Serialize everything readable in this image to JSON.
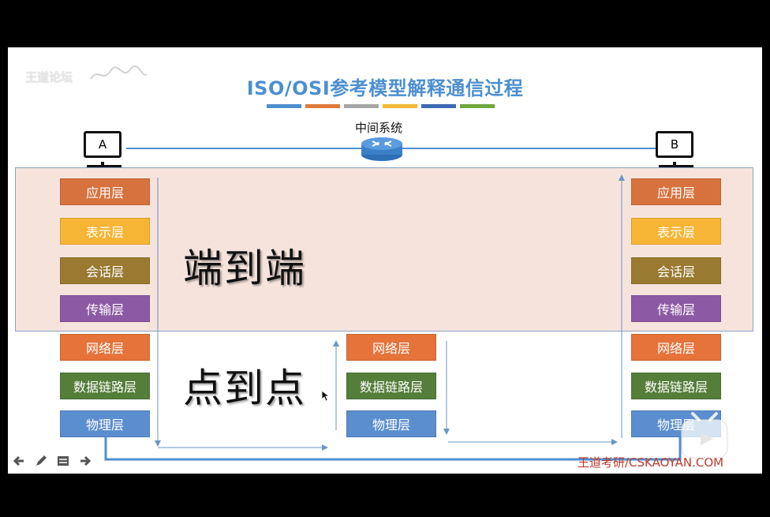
{
  "slide": {
    "title": "ISO/OSI参考模型解释通信过程",
    "watermark_text": "王道论坛",
    "title_bar_colors": [
      "#4f8fd0",
      "#e07b39",
      "#a6a6a6",
      "#f5b935",
      "#3f68b3",
      "#6fa83d"
    ]
  },
  "network": {
    "host_a_label": "A",
    "host_b_label": "B",
    "middle_system_label": "中间系统",
    "line_color": "#4f8fd0",
    "router_color": "#3c7fc9"
  },
  "regions": {
    "end_to_end_label": "端到端",
    "point_to_point_label": "点到点",
    "end_to_end_bg": "#f6e4dc"
  },
  "stack_a": [
    {
      "label": "应用层",
      "color": "#d7723e"
    },
    {
      "label": "表示层",
      "color": "#f6b535"
    },
    {
      "label": "会话层",
      "color": "#9a7a31"
    },
    {
      "label": "传输层",
      "color": "#8c5aa5"
    },
    {
      "label": "网络层",
      "color": "#e5733a"
    },
    {
      "label": "数据链路层",
      "color": "#547e3a"
    },
    {
      "label": "物理层",
      "color": "#5b8ecf"
    }
  ],
  "stack_mid": [
    {
      "label": "网络层",
      "color": "#e5733a"
    },
    {
      "label": "数据链路层",
      "color": "#547e3a"
    },
    {
      "label": "物理层",
      "color": "#5b8ecf"
    }
  ],
  "stack_b": [
    {
      "label": "应用层",
      "color": "#d7723e"
    },
    {
      "label": "表示层",
      "color": "#f6b535"
    },
    {
      "label": "会话层",
      "color": "#9a7a31"
    },
    {
      "label": "传输层",
      "color": "#8c5aa5"
    },
    {
      "label": "网络层",
      "color": "#e5733a"
    },
    {
      "label": "数据链路层",
      "color": "#547e3a"
    },
    {
      "label": "物理层",
      "color": "#5b8ecf"
    }
  ],
  "footer": {
    "text": "王道考研/CSKAOYAN.COM",
    "color": "#c0392b"
  },
  "controls": {
    "icons": [
      "arrow-left-icon",
      "pen-icon",
      "menu-icon",
      "arrow-right-icon"
    ]
  }
}
